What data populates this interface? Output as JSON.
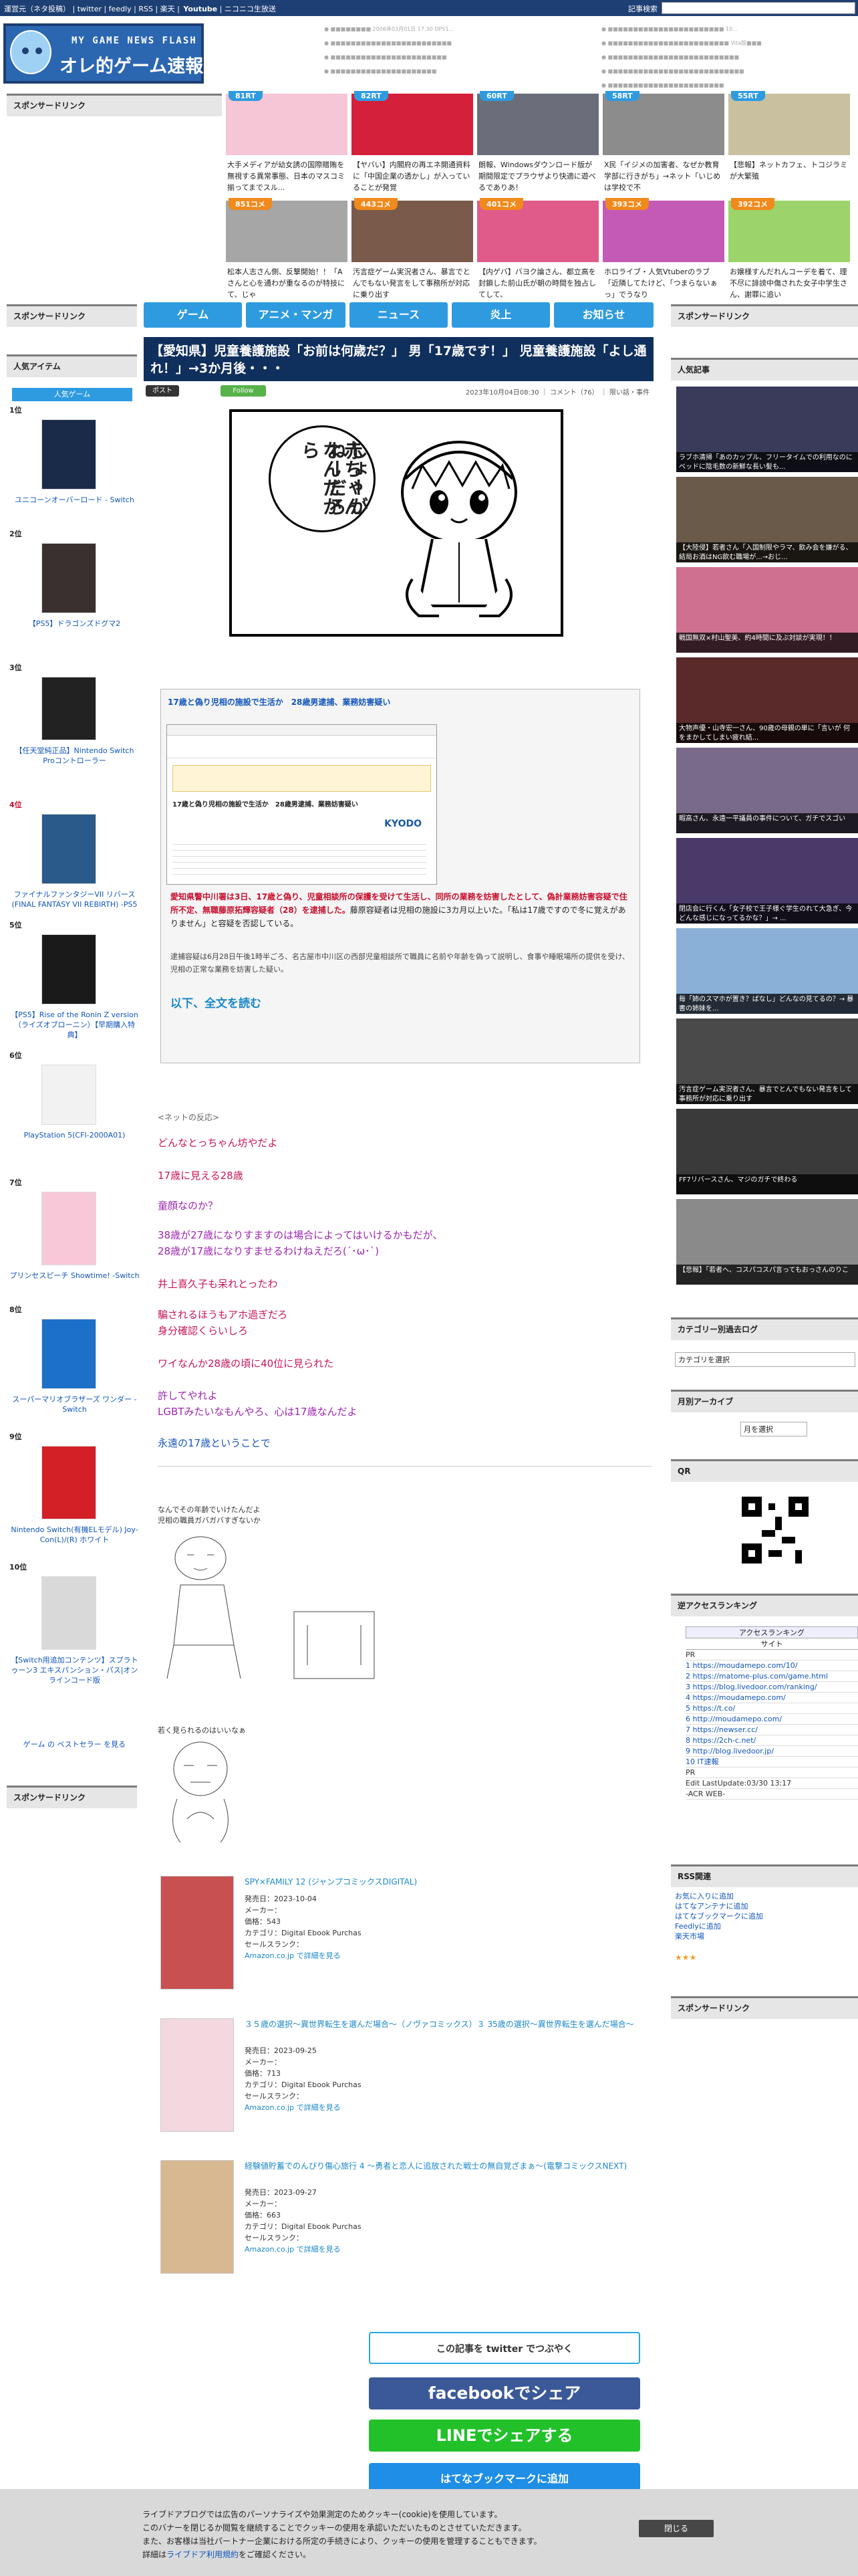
{
  "topbar": {
    "links": "運営元（ネタ投稿） | twitter | feedly | RSS | 楽天 |",
    "youtube": "Youtube",
    "niconico": "| ニコニコ生放送",
    "search_label": "記事検索"
  },
  "logo": {
    "small": "MY GAME NEWS FLASH",
    "big": "オレ的ゲーム速報@JIN"
  },
  "header_links_left": [
    "■■■■■■■■ 2006年03月01日 17:30 DPS1...",
    "■■■■■■■■■■■■■■■■■■■■■■■■",
    "■■■■■■■■■■■■■■■■■■■■■■■",
    "■■■■■■■■■■■■■■■■■■■■■"
  ],
  "header_links_right": [
    "■■■■■■■■■■■■■■■■■■■■■■■ 10...",
    "■■■■■■■■■■■■■■■■■■■■■■■■ Vita版■■■",
    "■■■■■■■■■■■■■■■■■■■■■■■■■■",
    "■■■■■■■■■■■■■■■■■■■■■■■■■■■",
    "■■■■■■■■■■■■■■■■■■■■■■■"
  ],
  "left_sponsor": "スポンサードリンク",
  "top_grid": {
    "row1": [
      {
        "rank": "81RT",
        "title": "大手メディアが幼女誘の国際贈賄を無視する異常事態、日本のマスコミ揃ってまでスル...",
        "color": "#2e9be0"
      },
      {
        "rank": "82RT",
        "title": "【ヤバい】内閣府の再エネ開通資料に「中国企業の透かし」が入っていることが発覚",
        "color": "#2e9be0"
      },
      {
        "rank": "60RT",
        "title": "朗報、Windowsダウンロード版が期間限定でプラウザより快適に遊べるでありあ！",
        "color": "#2e9be0"
      },
      {
        "rank": "58RT",
        "title": "X民「イジメの加害者、なぜか教育学部に行きがち」→ネット「いじめは学校で不",
        "color": "#2e9be0"
      },
      {
        "rank": "55RT",
        "title": "【悲報】ネットカフェ、トコジラミが大繁殖",
        "color": "#2e9be0"
      }
    ],
    "row2": [
      {
        "rank": "851コメ",
        "title": "松本人志さん側、反撃開始！！「Aさんと心を通わが重なるのが特技にて、じゃ",
        "color": "#f08a1c"
      },
      {
        "rank": "443コメ",
        "title": "汚言症ゲーム実況者さん、暴言でとんでもない発言をして事務所が対応に乗り出す",
        "color": "#f08a1c"
      },
      {
        "rank": "401コメ",
        "title": "【内ゲバ】バヨク論さん、都立高を封鎖した前山氏が朝の時間を独占してして、",
        "color": "#f08a1c"
      },
      {
        "rank": "393コメ",
        "title": "ホロライブ・人気Vtuberのラブ「近隣してたけど、「つまらないぁっ」でうなり",
        "color": "#f08a1c"
      },
      {
        "rank": "392コメ",
        "title": "お嬢様すんだれんコーデを着て、理不尽に誹謗中傷された女子中学生さん、謝罪に追い",
        "color": "#f08a1c"
      }
    ]
  },
  "nav": [
    "ゲーム",
    "アニメ・マンガ",
    "ニュース",
    "炎上",
    "お知らせ"
  ],
  "article": {
    "title": "【愛知県】児童養護施設「お前は何歳だ？」 男「17歳です！」 児童養護施設「よし通れ！」→3か月後・・・",
    "tweet": "ポスト",
    "follow": "Follow",
    "meta": "2023年10月04日08:30 ｜ コメント（76） ｜ 限い話・事件",
    "comic_line1": "しょーがねーだろ",
    "comic_line2": "赤ちゃんなんだから",
    "source_head": "17歳と偽り児相の施設で生活か　28歳男逮捕、業務妨害疑い",
    "source_ss_title": "17歳と偽り児相の施設で生活か　28歳男逮捕、業務妨害疑い",
    "source_ss_logo": "KYODO",
    "source_body_red": "愛知県警中川署は3日、17歳と偽り、児童相談所の保護を受けて生活し、同所の業務を妨害したとして、偽計業務妨害容疑で住所不定、無職藤原拓輝容疑者（28）を逮捕した。",
    "source_body_black": "藤原容疑者は児相の施設に3カ月以上いた。「私は17歳ですので冬に覚えがありません」と容疑を否認している。",
    "source_body2": "逮捕容疑は6月28日午後1時半ごろ、名古屋市中川区の西部児童相談所で職員に名前や年齢を偽って説明し、食事や睡眠場所の提供を受け、児相の正常な業務を妨害した疑い。",
    "read_more": "以下、全文を読む"
  },
  "comments_head": "<ネットの反応>",
  "comments": [
    {
      "text": "どんなとっちゃん坊やだよ",
      "color": "#c8175a"
    },
    {
      "text": "17歳に見える28歳",
      "color": "#c8175a"
    },
    {
      "text": "童顔なのか？",
      "color": "#9d27b0"
    },
    {
      "text": "38歳が27歳になりすますのは場合によってはいけるかもだが、",
      "color": "#9d27b0"
    },
    {
      "text": "28歳が17歳になりすませるわけねえだろ(´･ω･`)",
      "color": "#9d27b0"
    },
    {
      "text": "井上喜久子も呆れとったわ",
      "color": "#c8175a"
    },
    {
      "text": "騙されるほうもアホ過ぎだろ",
      "color": "#c8175a"
    },
    {
      "text": "身分確認くらいしろ",
      "color": "#c8175a"
    },
    {
      "text": "ワイなんか28歳の頃に40位に見られた",
      "color": "#c8175a"
    },
    {
      "text": "許してやれよ",
      "color": "#9d27b0"
    },
    {
      "text": "LGBTみたいなもんやろ、心は17歳なんだよ",
      "color": "#9d27b0"
    },
    {
      "text": "永遠の17歳ということで",
      "color": "#1a55bb"
    }
  ],
  "aa1_caption": "なんでその年齢でいけたんだよ\n児相の職員ガバガバすぎないか",
  "aa2_caption": "若く見られるのはいいなぁ",
  "products": [
    {
      "title": "SPY×FAMILY 12 (ジャンプコミックスDIGITAL)",
      "lines": [
        "発売日：2023-10-04",
        "メーカー：",
        "価格：543",
        "カテゴリ：Digital Ebook Purchas",
        "セールスランク："
      ],
      "link": "Amazon.co.jp で詳細を見る"
    },
    {
      "title": "３５歳の選択～異世界転生を選んだ場合～（ノヴァコミックス）３ 35歳の選択～異世界転生を選んだ場合～",
      "lines": [
        "発売日：2023-09-25",
        "メーカー：",
        "価格：713",
        "カテゴリ：Digital Ebook Purchas",
        "セールスランク："
      ],
      "link": "Amazon.co.jp で詳細を見る"
    },
    {
      "title": "経験値貯蓄でのんびり傷心旅行 4 ～勇者と恋人に追放された戦士の無自覚ざまぁ～(電撃コミックスNEXT)",
      "lines": [
        "発売日：2023-09-27",
        "メーカー：",
        "価格：663",
        "カテゴリ：Digital Ebook Purchas",
        "セールスランク："
      ],
      "link": "Amazon.co.jp で詳細を見る"
    }
  ],
  "share": {
    "twitter": "この記事を twitter でつぶやく",
    "facebook": "facebookでシェア",
    "line": "LINEでシェアする",
    "hatena": "はてなブックマークに追加"
  },
  "left_col": {
    "sponsor2": "スポンサードリンク",
    "popular_head": "人気アイテム",
    "popular_tab": "人気ゲーム",
    "items": [
      {
        "rank": "1位",
        "name": "ユニコーンオーバーロード - Switch"
      },
      {
        "rank": "2位",
        "name": "【PS5】ドラゴンズドグマ2"
      },
      {
        "rank": "3位",
        "name": "【任天堂純正品】Nintendo Switch Proコントローラー"
      },
      {
        "rank": "4位",
        "name": "ファイナルファンタジーVII リバース(FINAL FANTASY VII REBIRTH) -PS5"
      },
      {
        "rank": "5位",
        "name": "【PS5】Rise of the Ronin Z version（ライズオブローニン）【早期購入特典】"
      },
      {
        "rank": "6位",
        "name": "PlayStation 5(CFI-2000A01)"
      },
      {
        "rank": "7位",
        "name": "プリンセスピーチ Showtime! -Switch"
      },
      {
        "rank": "8位",
        "name": "スーパーマリオブラザーズ ワンダー -Switch"
      },
      {
        "rank": "9位",
        "name": "Nintendo Switch(有機ELモデル) Joy-Con(L)/(R) ホワイト"
      },
      {
        "rank": "10位",
        "name": "【Switch用追加コンテンツ】スプラトゥーン3 エキスパンション・パス|オンラインコード版"
      }
    ],
    "bestseller": "ゲーム の ベストセラー を見る",
    "sponsor3": "スポンサードリンク"
  },
  "right_col": {
    "sponsor": "スポンサードリンク",
    "popular_head": "人気記事",
    "popular": [
      "ラブホ清掃「あのカップル、フリータイムでの利用なのにベッドに陰毛数の新鮮な長い髪も...",
      "【大陸侵】若者さん「入国制限やラマ、飲み会を嫌がる、結局お酒はNG飲む職場が...→おじ...",
      "戦国無双×村山聖美、約4時間に及ぶ対談が実現！！",
      "大物声優・山寺宏一さん、90歳の母親の単に「言いが 何をまかしてしまい疲れ結... ",
      "暇高さん、永遠一平議員の事件について、ガチでスゴい",
      "閉店会に行くん「女子校で王子様ぐ学生のれて大急ぎ、今どんな感じになってるかな？」→ ...",
      "毎「姉のスマホが置き？ばなし」どんなの見てるの？→ 暴書の姉妹を...",
      "汚言症ゲーム実況者さん、暴言でとんでもない発言をして事務所が対応に乗り出す",
      "FF7リバースさん、マジのガチで終わる",
      "【悲報】「若者へ、コスパコスパ言ってもおっさんのりこ"
    ],
    "cat_log": "カテゴリー別過去ログ",
    "cat_select": "カテゴリを選択",
    "monthly": "月別アーカイブ",
    "month_select": "月を選択",
    "qr": "QR",
    "reverse": "逆アクセスランキング",
    "acr_title": "アクセスランキング",
    "acr_sub": "サイト",
    "acr_rows": [
      "PR",
      "1 https://moudamepo.com/10/",
      "2 https://matome-plus.com/game.html",
      "3 https://blog.livedoor.com/ranking/",
      "4 https://moudamepo.com/",
      "5 https://t.co/",
      "6 http://moudamepo.com/",
      "7 https://newser.cc/",
      "8 https://2ch-c.net/",
      "9 http://blog.livedoor.jp/",
      "10 IT速報",
      "PR",
      "Edit LastUpdate:03/30 13:17",
      "-ACR WEB-"
    ],
    "rss_head": "RSS関連",
    "rss_links": [
      "お気に入りに追加",
      "はてなアンテナに追加",
      "はてなブックマークに追加",
      "Feedlyに追加",
      "楽天市場"
    ],
    "sponsor2": "スポンサードリンク"
  },
  "cookie": {
    "line1": "ライブドアブログでは広告のパーソナライズや効果測定のためクッキー(cookie)を使用しています。",
    "line2": "このバナーを閉じるか閲覧を継続することでクッキーの使用を承認いただいたものとさせていただきます。",
    "line3": "また、お客様は当社パートナー企業における所定の手続きにより、クッキーの使用を管理することもできます。",
    "line4_pre": "詳細は",
    "line4_link": "ライブドア利用規約",
    "line4_post": "をご確認ください。",
    "close": "閉じる"
  }
}
